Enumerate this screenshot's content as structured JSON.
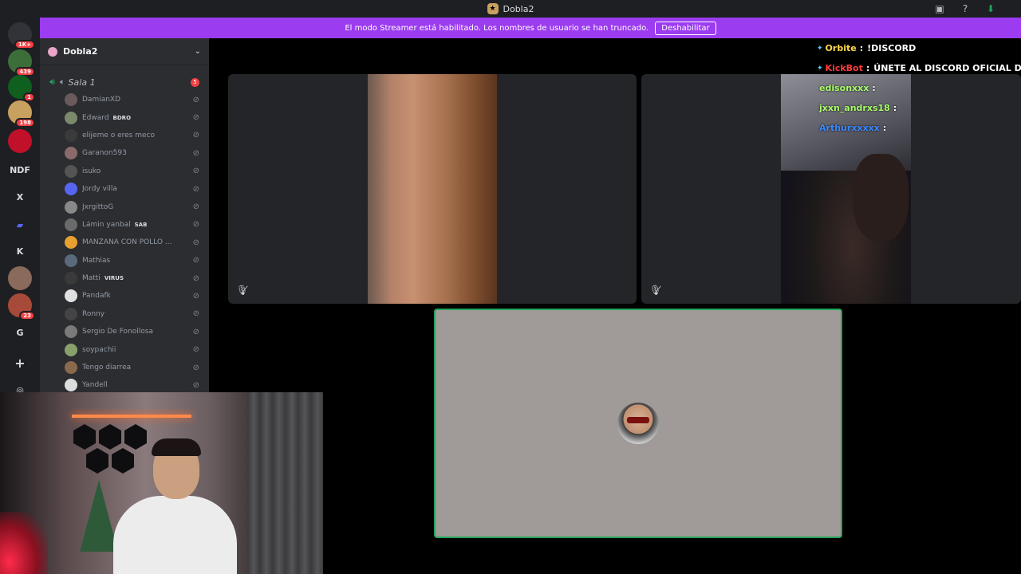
{
  "titlebar": {
    "title": "Dobla2"
  },
  "guilds": [
    {
      "name": "discord-home",
      "label": "",
      "badge": "1K+",
      "color": "#313338"
    },
    {
      "name": "server-1",
      "label": "",
      "badge": "439",
      "color": "#3c6e3a"
    },
    {
      "name": "server-2",
      "label": "",
      "badge": "1",
      "color": "#0f5f1f"
    },
    {
      "name": "server-3",
      "label": "",
      "badge": "198",
      "color": "#c8a060"
    },
    {
      "name": "server-4",
      "label": "",
      "badge": "",
      "color": "#c0102a"
    },
    {
      "name": "server-ndf",
      "label": "NDF",
      "badge": "",
      "color": "#1e1f22"
    },
    {
      "name": "server-x",
      "label": "X",
      "badge": "",
      "color": "#1e1f22"
    },
    {
      "name": "server-folder",
      "label": "",
      "badge": "",
      "color": "#1e1f22"
    },
    {
      "name": "server-k",
      "label": "K",
      "badge": "",
      "color": "#1e1f22"
    },
    {
      "name": "server-5",
      "label": "",
      "badge": "",
      "color": "#8a6a5a"
    },
    {
      "name": "server-6",
      "label": "",
      "badge": "23",
      "color": "#a84a3a"
    },
    {
      "name": "server-g",
      "label": "G",
      "badge": "",
      "color": "#1e1f22"
    }
  ],
  "banner": {
    "text": "El modo Streamer está habilitado. Los nombres de usuario se han truncado.",
    "button": "Deshabilitar"
  },
  "server": {
    "name": "Dobla2"
  },
  "voice_channel": {
    "name": "Sala 1",
    "count": "5"
  },
  "users": [
    {
      "name": "DamianXD",
      "tag": "",
      "color": "#6a5a5a"
    },
    {
      "name": "Edward",
      "tag": "BDRO",
      "color": "#7a8a6a"
    },
    {
      "name": "elijeme o eres meco",
      "tag": "",
      "color": "#3a3a3a"
    },
    {
      "name": "Garanon593",
      "tag": "",
      "color": "#8a6a6a"
    },
    {
      "name": "isuko",
      "tag": "",
      "color": "#555"
    },
    {
      "name": "Jordy villa",
      "tag": "",
      "color": "#5865f2"
    },
    {
      "name": "JxrgittoG",
      "tag": "",
      "color": "#888"
    },
    {
      "name": "Lámin yanbal",
      "tag": "SAB",
      "color": "#6a6a6a"
    },
    {
      "name": "MANZANA CON POLLO ...",
      "tag": "",
      "color": "#e8a030"
    },
    {
      "name": "Mathias",
      "tag": "",
      "color": "#5a6a7a"
    },
    {
      "name": "Matti",
      "tag": "VIRUS",
      "color": "#3a3a3a"
    },
    {
      "name": "Pandafk",
      "tag": "",
      "color": "#e0e0e0"
    },
    {
      "name": "Ronny",
      "tag": "",
      "color": "#444"
    },
    {
      "name": "Sergio De Fonollosa",
      "tag": "",
      "color": "#7a7a7a"
    },
    {
      "name": "soypachii",
      "tag": "",
      "color": "#8aa06a"
    },
    {
      "name": "Tengo diarrea",
      "tag": "",
      "color": "#8a6a4a"
    },
    {
      "name": "Yandell",
      "tag": "",
      "color": "#ddd"
    }
  ],
  "chat": [
    {
      "user": "Orbite",
      "msg": "!DISCORD",
      "color": "#ffd84a"
    },
    {
      "user": "KickBot",
      "msg": "ÚNETE AL DISCORD OFICIAL DE",
      "color": "#ff3a3a"
    },
    {
      "user": "edisonxxx",
      "msg": "",
      "color": "#a8ff6a"
    },
    {
      "user": "jxxn_andrxs18",
      "msg": "",
      "color": "#a8ff6a"
    },
    {
      "user": "Arthurxxxxx",
      "msg": "",
      "color": "#3a8aff"
    }
  ],
  "colors": {
    "accent_purple": "#9b3cf0",
    "speaking_green": "#23a55a",
    "mention_red": "#f23f43"
  }
}
